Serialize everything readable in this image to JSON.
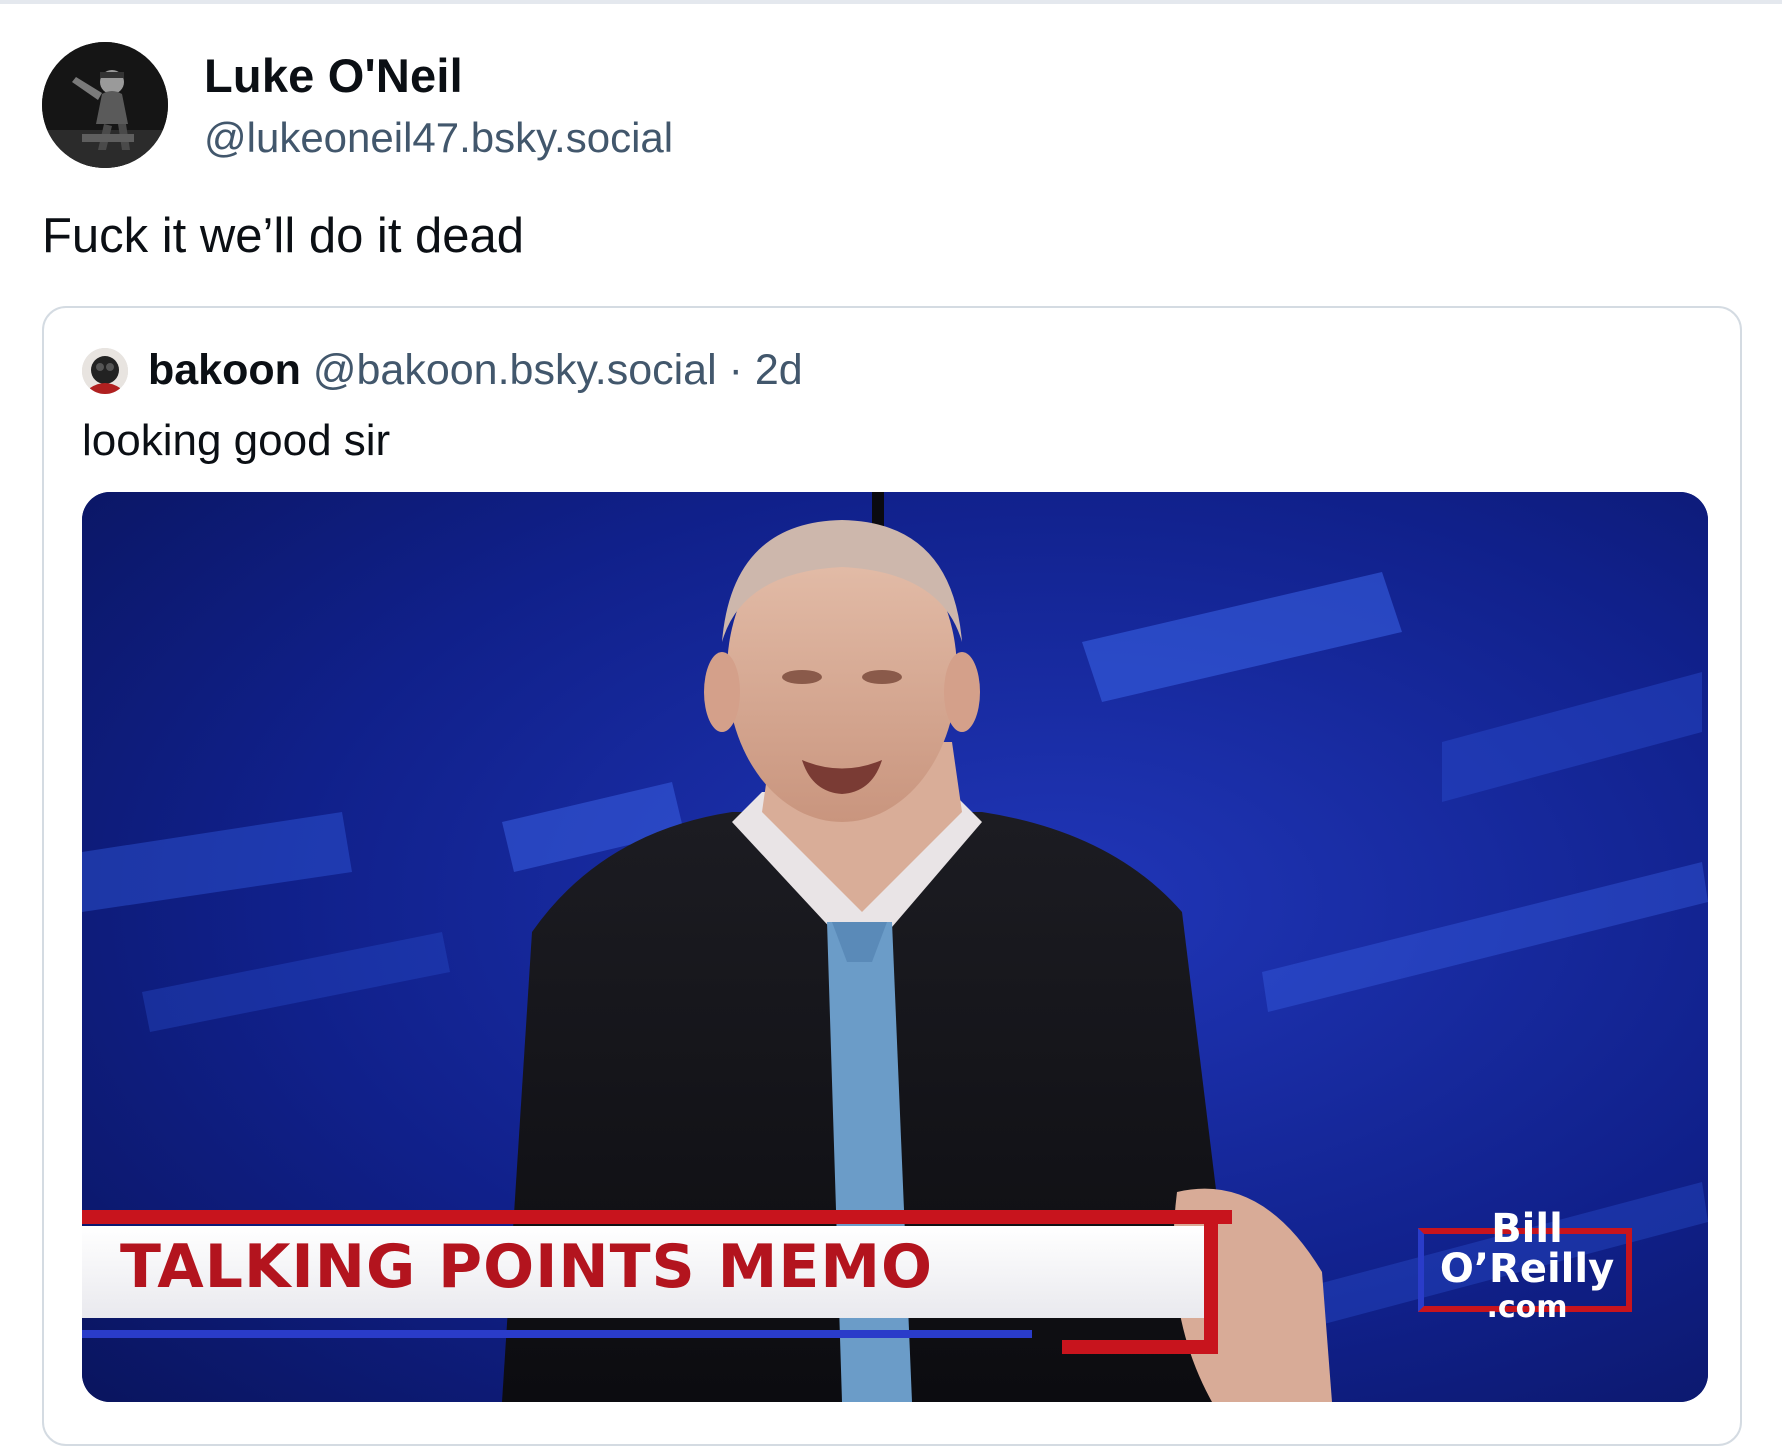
{
  "post": {
    "author_name": "Luke O'Neil",
    "author_handle": "@lukeoneil47.bsky.social",
    "text": "Fuck it we’ll do it dead"
  },
  "quoted_post": {
    "author_name": "bakoon",
    "author_handle": "@bakoon.bsky.social",
    "separator": " · ",
    "age": "2d",
    "text": "looking good sir",
    "media": {
      "lower_third_title": "TALKING POINTS MEMO",
      "logo_line1": "Bill",
      "logo_line2": "O’Reilly",
      "logo_line3": ".com"
    }
  },
  "colors": {
    "text_primary": "#0b0f14",
    "text_secondary": "#42576c",
    "card_border": "#d4dbe2",
    "broadcast_red": "#c8141d",
    "broadcast_blue": "#2a3cc9"
  }
}
